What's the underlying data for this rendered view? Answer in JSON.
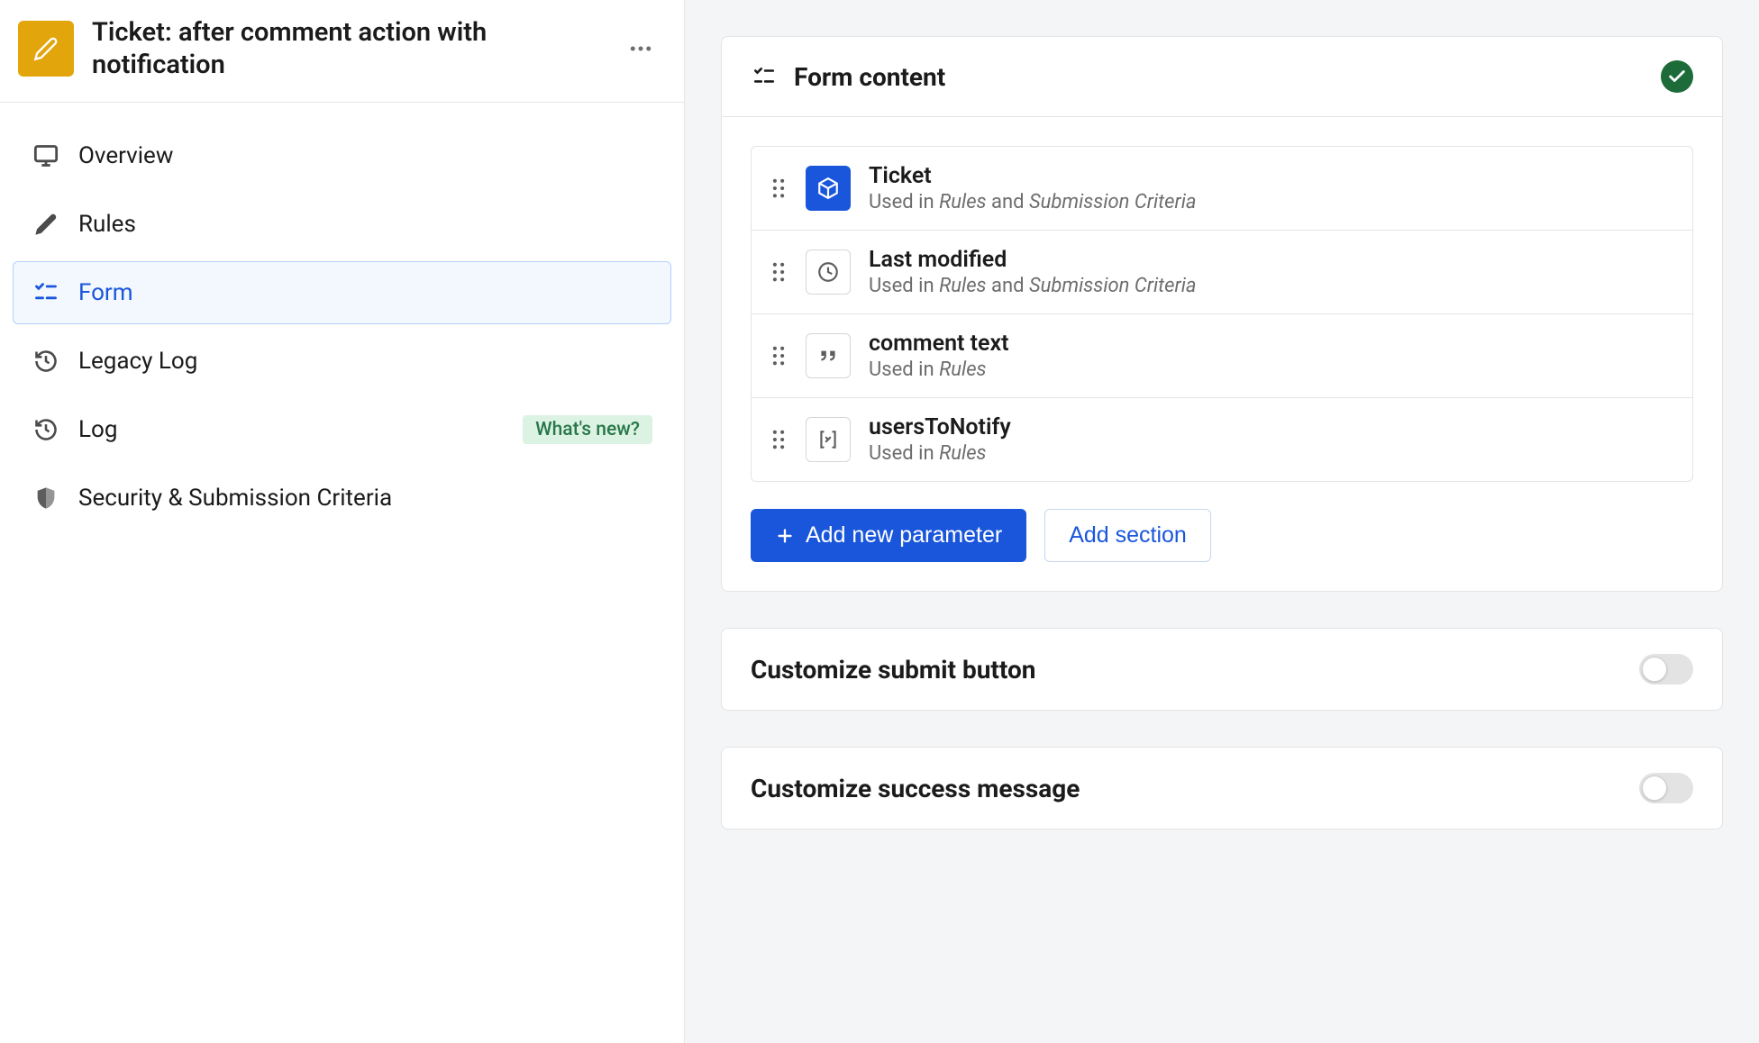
{
  "header": {
    "title": "Ticket: after comment action with notification"
  },
  "sidebar": {
    "items": [
      {
        "label": "Overview"
      },
      {
        "label": "Rules"
      },
      {
        "label": "Form"
      },
      {
        "label": "Legacy Log"
      },
      {
        "label": "Log",
        "badge": "What's new?"
      },
      {
        "label": "Security & Submission Criteria"
      }
    ]
  },
  "main": {
    "form_content": {
      "title": "Form content",
      "rows": [
        {
          "title": "Ticket",
          "used_in_prefix": "Used in ",
          "used_in_1": "Rules",
          "used_in_sep": " and ",
          "used_in_2": "Submission Criteria"
        },
        {
          "title": "Last modified",
          "used_in_prefix": "Used in ",
          "used_in_1": "Rules",
          "used_in_sep": " and ",
          "used_in_2": "Submission Criteria"
        },
        {
          "title": "comment text",
          "used_in_prefix": "Used in ",
          "used_in_1": "Rules"
        },
        {
          "title": "usersToNotify",
          "used_in_prefix": "Used in ",
          "used_in_1": "Rules"
        }
      ],
      "add_parameter_label": "Add new parameter",
      "add_section_label": "Add section"
    },
    "customize_submit": {
      "title": "Customize submit button"
    },
    "customize_success": {
      "title": "Customize success message"
    }
  }
}
